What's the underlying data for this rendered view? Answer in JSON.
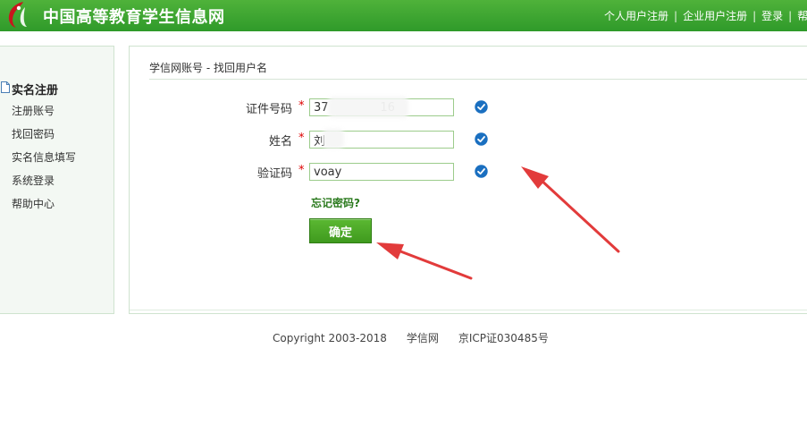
{
  "header": {
    "site_title": "中国高等教育学生信息网",
    "nav": {
      "personal_register": "个人用户注册",
      "enterprise_register": "企业用户注册",
      "login": "登录",
      "truncated": "帮",
      "separator": "|"
    }
  },
  "sidebar": {
    "title": "实名注册",
    "items": [
      {
        "label": "注册账号"
      },
      {
        "label": "找回密码"
      },
      {
        "label": "实名信息填写"
      },
      {
        "label": "系统登录"
      },
      {
        "label": "帮助中心"
      }
    ]
  },
  "main": {
    "breadcrumb": "学信网账号 - 找回用户名",
    "required_mark": "*",
    "fields": {
      "id_number": {
        "label": "证件号码",
        "value": "37              16"
      },
      "name": {
        "label": "姓名",
        "value": "刘"
      },
      "captcha": {
        "label": "验证码",
        "value": "voay"
      }
    },
    "forgot_link": "忘记密码?",
    "submit_label": "确定"
  },
  "footer": {
    "copyright": "Copyright 2003-2018",
    "site": "学信网",
    "icp": "京ICP证030485号"
  },
  "colors": {
    "header_green": "#3aa52f",
    "check_blue": "#1a6fc0",
    "arrow_red": "#e23b3b",
    "required_red": "#dd0000"
  }
}
